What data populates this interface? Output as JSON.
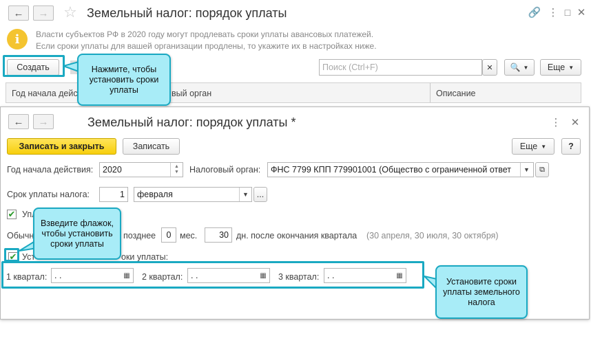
{
  "back_window": {
    "title": "Земельный налог: порядок уплаты",
    "info_line1": "Власти субъектов РФ в 2020 году могут продлевать сроки уплаты авансовых платежей.",
    "info_line2": "Если сроки уплаты для вашей организации продлены, то укажите их в настройках ниже.",
    "create_label": "Создать",
    "search_placeholder": "Поиск (Ctrl+F)",
    "search_icon_glyph": "🔍",
    "more_label": "Еще",
    "columns": [
      "Год начала дейс",
      "вый орган",
      "Описание"
    ]
  },
  "front_window": {
    "title": "Земельный налог: порядок уплаты *",
    "save_close_label": "Записать и закрыть",
    "save_label": "Записать",
    "more_label": "Еще",
    "help_label": "?",
    "year_label": "Год начала действия:",
    "year_value": "2020",
    "tax_org_label": "Налоговый орган:",
    "tax_org_value": "ФНС 7799 КПП 779901001 (Общество с ограниченной ответ",
    "pay_term_label": "Срок уплаты налога:",
    "pay_day": "1",
    "pay_month": "февраля",
    "ellipsis": "...",
    "checkbox1_label": "Упл",
    "usual_prefix": "Обычн",
    "usual_mid": "позднее",
    "months_value": "0",
    "months_label": "мес.",
    "days_value": "30",
    "days_label": "дн. после окончания квартала",
    "dates_hint": "(30 апреля, 30 июля, 30 октября)",
    "checkbox2_prefix": "Уст",
    "checkbox2_suffix": "оки уплаты:",
    "q1_label": "1 квартал:",
    "q2_label": "2 квартал:",
    "q3_label": "3 квартал:",
    "date_empty": " .  .",
    "checkmark": "✔"
  },
  "callouts": {
    "create": "Нажмите, чтобы установить сроки уплаты",
    "checkbox": "Взведите флажок, чтобы установить сроки уплаты",
    "quarters": "Установите сроки уплаты земельного налога"
  },
  "colors": {
    "accent": "#1aa9c2",
    "callout_fill": "#a8ecf7",
    "primary_button": "#f7cf0d"
  }
}
